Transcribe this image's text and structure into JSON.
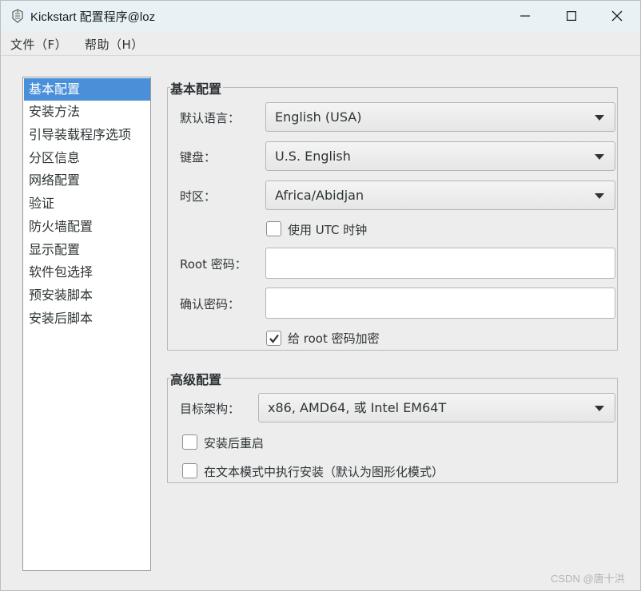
{
  "window": {
    "title": "Kickstart 配置程序@loz",
    "icon": "kickstart-app-icon"
  },
  "menubar": {
    "file": "文件（F）",
    "help": "帮助（H）"
  },
  "sidebar": {
    "items": [
      {
        "label": "基本配置",
        "selected": true
      },
      {
        "label": "安装方法",
        "selected": false
      },
      {
        "label": "引导装载程序选项",
        "selected": false
      },
      {
        "label": "分区信息",
        "selected": false
      },
      {
        "label": "网络配置",
        "selected": false
      },
      {
        "label": "验证",
        "selected": false
      },
      {
        "label": "防火墙配置",
        "selected": false
      },
      {
        "label": "显示配置",
        "selected": false
      },
      {
        "label": "软件包选择",
        "selected": false
      },
      {
        "label": "预安装脚本",
        "selected": false
      },
      {
        "label": "安装后脚本",
        "selected": false
      }
    ]
  },
  "basic": {
    "title": "基本配置",
    "language_label": "默认语言：",
    "language_value": "English (USA)",
    "keyboard_label": "键盘：",
    "keyboard_value": "U.S. English",
    "timezone_label": "时区：",
    "timezone_value": "Africa/Abidjan",
    "utc_label": "使用 UTC 时钟",
    "utc_checked": false,
    "root_password_label": "Root 密码：",
    "root_password_value": "",
    "confirm_password_label": "确认密码：",
    "confirm_password_value": "",
    "encrypt_label": "给 root 密码加密",
    "encrypt_checked": true
  },
  "advanced": {
    "title": "高级配置",
    "arch_label": "目标架构：",
    "arch_value": "x86, AMD64, 或 Intel EM64T",
    "reboot_label": "安装后重启",
    "reboot_checked": false,
    "textmode_label": "在文本模式中执行安装（默认为图形化模式）",
    "textmode_checked": false
  },
  "watermark": "CSDN @唐十洪",
  "colors": {
    "selection": "#4a90d9",
    "titlebar": "#e8f2f6",
    "window_bg": "#ededed"
  }
}
